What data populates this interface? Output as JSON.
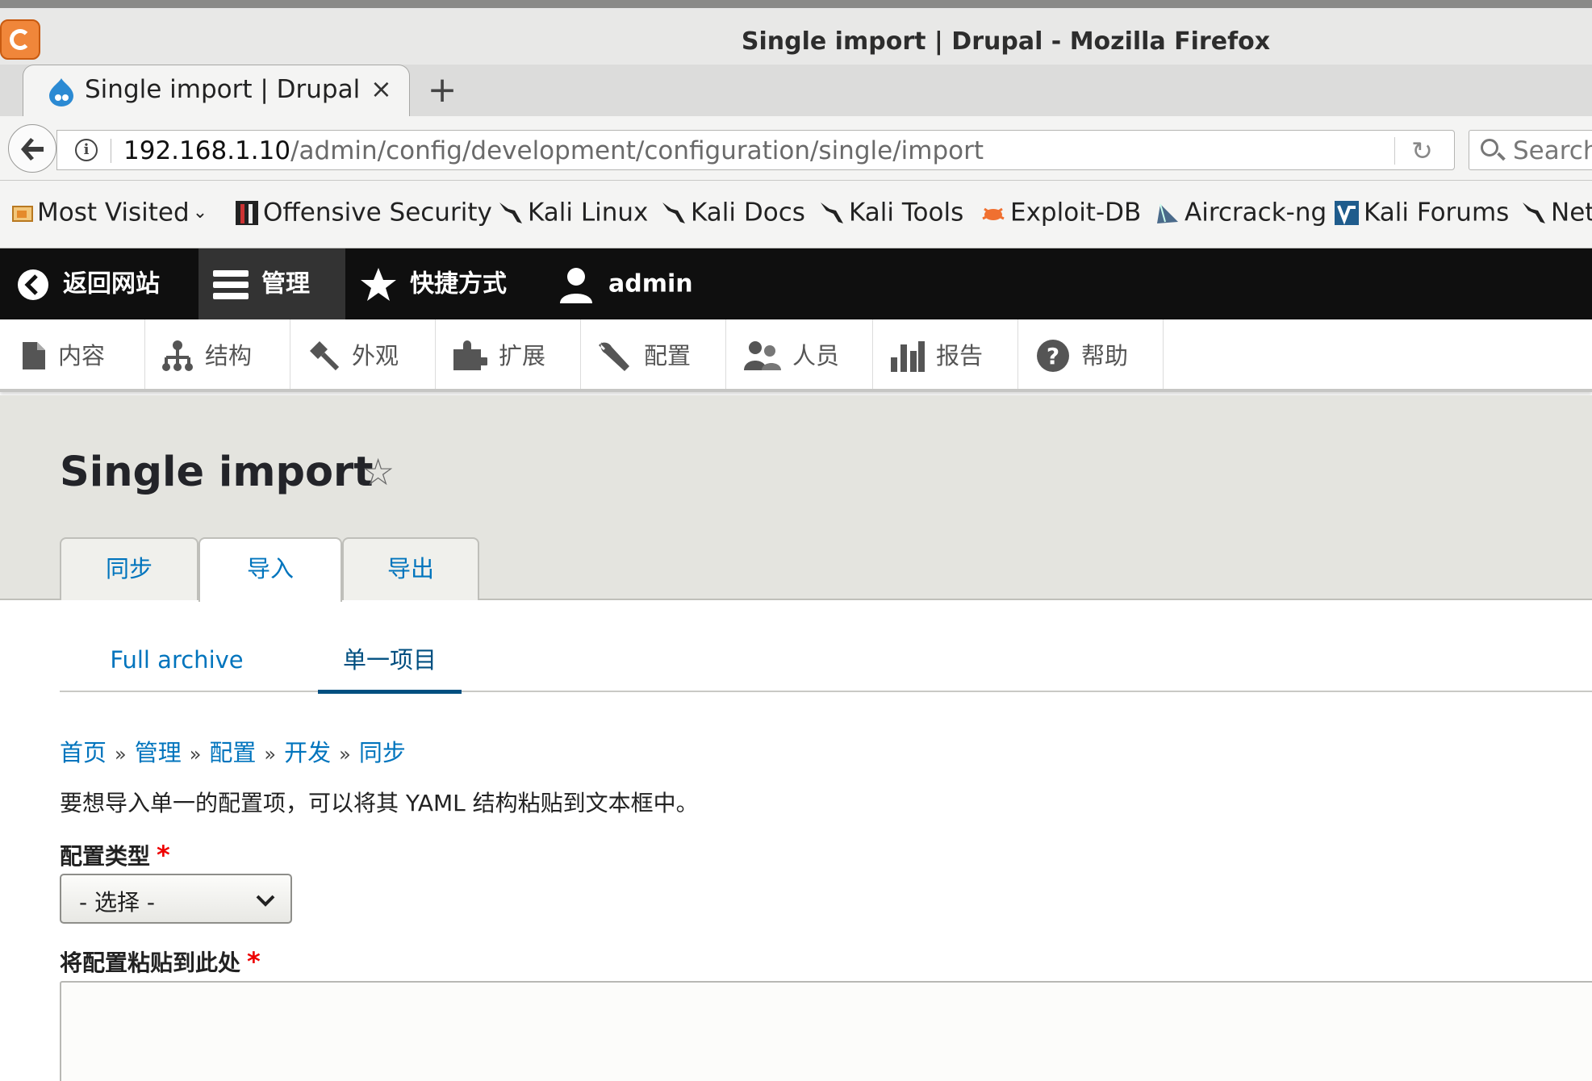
{
  "window": {
    "title": "Single import | Drupal - Mozilla Firefox"
  },
  "browser": {
    "tab": {
      "label": "Single import | Drupal",
      "close": "×"
    },
    "new_tab": "+",
    "url": {
      "host": "192.168.1.10",
      "path": "/admin/config/development/configuration/single/import"
    },
    "search_placeholder": "Search",
    "bookmarks": [
      {
        "label": "Most Visited",
        "icon": "folder-icon"
      },
      {
        "label": "Offensive Security",
        "icon": "offsec-icon"
      },
      {
        "label": "Kali Linux",
        "icon": "kali-dragon-icon"
      },
      {
        "label": "Kali Docs",
        "icon": "kali-dragon-icon"
      },
      {
        "label": "Kali Tools",
        "icon": "kali-dragon-icon"
      },
      {
        "label": "Exploit-DB",
        "icon": "exploitdb-icon"
      },
      {
        "label": "Aircrack-ng",
        "icon": "aircrack-icon"
      },
      {
        "label": "Kali Forums",
        "icon": "kali-forums-icon"
      },
      {
        "label": "Net",
        "icon": "kali-dragon-icon"
      }
    ]
  },
  "toolbar": {
    "back_to_site": "返回网站",
    "manage": "管理",
    "shortcuts": "快捷方式",
    "user": "admin"
  },
  "tray": [
    {
      "label": "内容",
      "icon": "content-icon"
    },
    {
      "label": "结构",
      "icon": "structure-icon"
    },
    {
      "label": "外观",
      "icon": "appearance-icon"
    },
    {
      "label": "扩展",
      "icon": "extend-icon"
    },
    {
      "label": "配置",
      "icon": "wrench-icon"
    },
    {
      "label": "人员",
      "icon": "people-icon"
    },
    {
      "label": "报告",
      "icon": "reports-icon"
    },
    {
      "label": "帮助",
      "icon": "help-icon"
    }
  ],
  "page": {
    "title": "Single import",
    "primary_tabs": [
      "同步",
      "导入",
      "导出"
    ],
    "active_primary_tab": "导入",
    "secondary_tabs": [
      "Full archive",
      "单一项目"
    ],
    "active_secondary_tab": "单一项目",
    "breadcrumb": [
      "首页",
      "管理",
      "配置",
      "开发",
      "同步"
    ],
    "breadcrumb_sep": "»",
    "help_text": "要想导入单一的配置项，可以将其 YAML 结构粘贴到文本框中。",
    "config_type_label": "配置类型",
    "config_type_value": "- 选择 -",
    "paste_label": "将配置粘贴到此处",
    "required_marker": "*"
  },
  "colors": {
    "link": "#0074bd",
    "toolbar_bg": "#0f0f0f",
    "required": "#ee0000"
  }
}
